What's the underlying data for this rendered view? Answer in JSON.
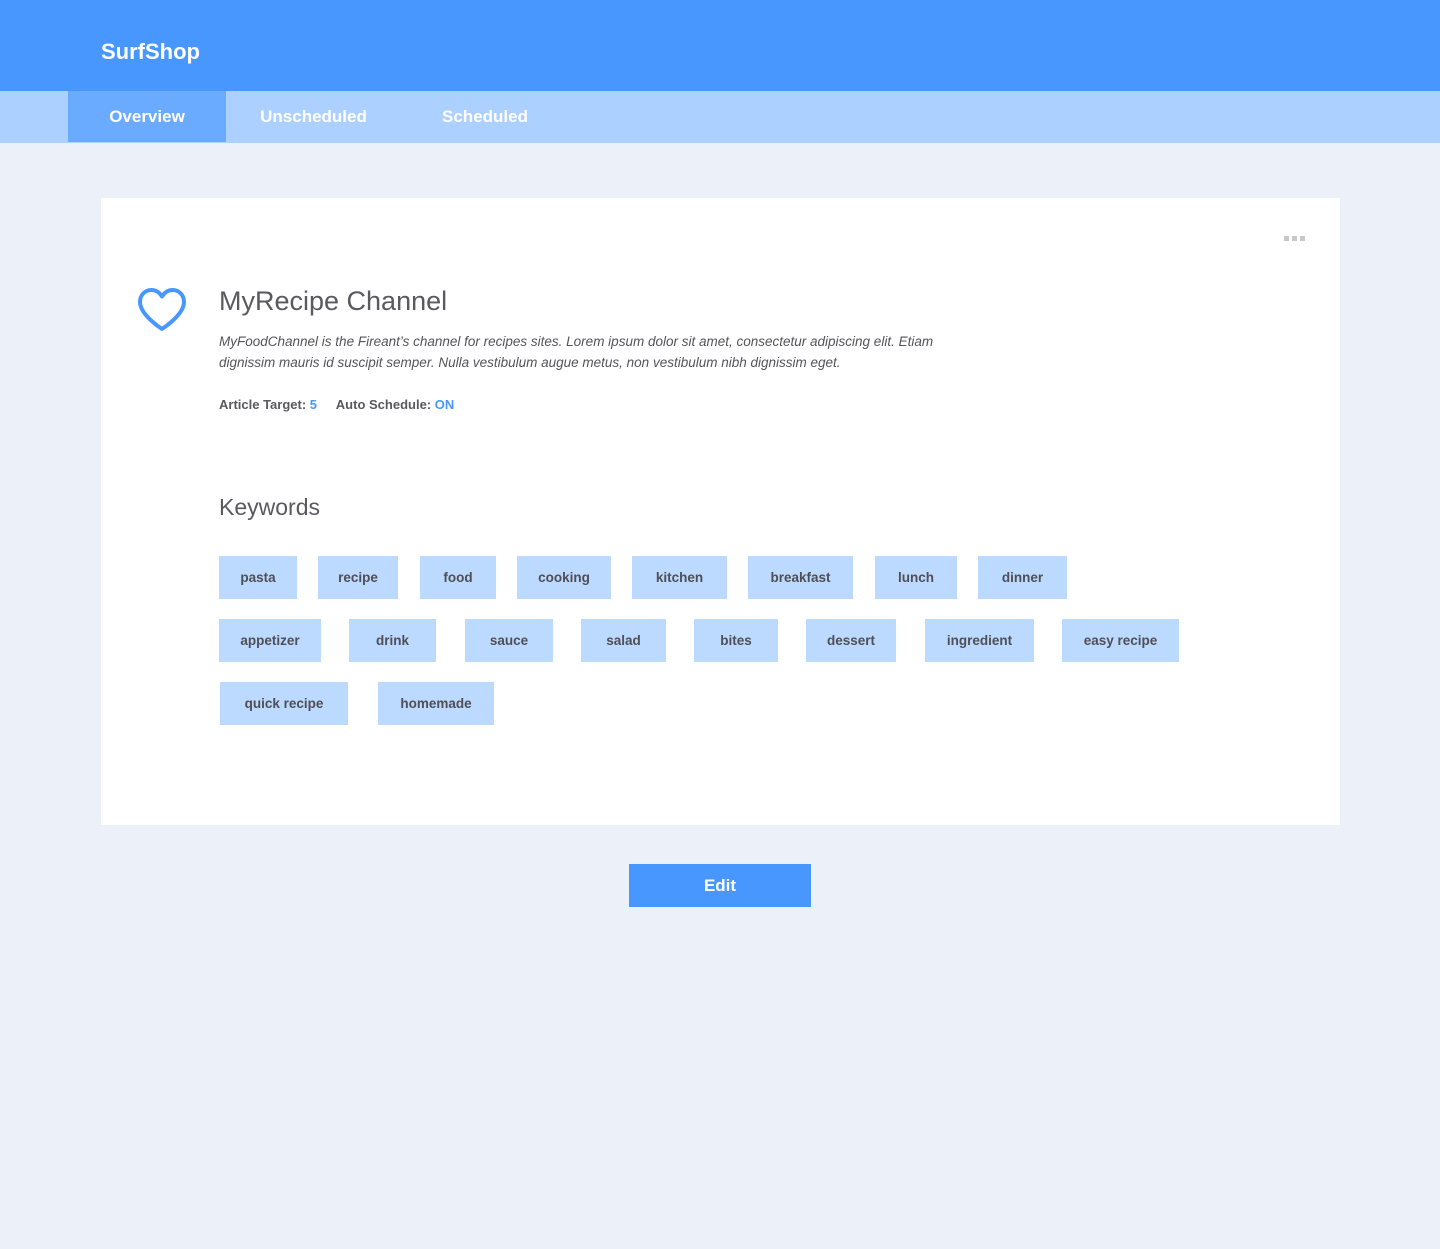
{
  "app": {
    "brand": "SurfShop"
  },
  "tabs": [
    {
      "label": "Overview",
      "active": true
    },
    {
      "label": "Unscheduled",
      "active": false
    },
    {
      "label": "Scheduled",
      "active": false
    }
  ],
  "channel": {
    "icon": "heart-icon",
    "title": "MyRecipe Channel",
    "description": "MyFoodChannel is the Fireant’s channel for recipes sites. Lorem ipsum dolor sit amet, consectetur adipiscing elit. Etiam dignissim mauris id suscipit semper. Nulla vestibulum augue metus, non vestibulum nibh dignissim eget.",
    "article_target_label": "Article Target:",
    "article_target_value": "5",
    "auto_schedule_label": "Auto Schedule:",
    "auto_schedule_value": "ON",
    "menu_icon": "more-icon"
  },
  "keywords": {
    "title": "Keywords",
    "items": [
      "pasta",
      "recipe",
      "food",
      "cooking",
      "kitchen",
      "breakfast",
      "lunch",
      "dinner",
      "appetizer",
      "drink",
      "sauce",
      "salad",
      "bites",
      "dessert",
      "ingredient",
      "easy recipe",
      "quick recipe",
      "homemade"
    ]
  },
  "actions": {
    "edit_label": "Edit"
  },
  "colors": {
    "primary": "#4897ff",
    "tabbar": "#acd0ff",
    "tab_active": "#6aabff",
    "tag_bg": "#bcd9ff",
    "page_bg": "#ecf0f8"
  }
}
